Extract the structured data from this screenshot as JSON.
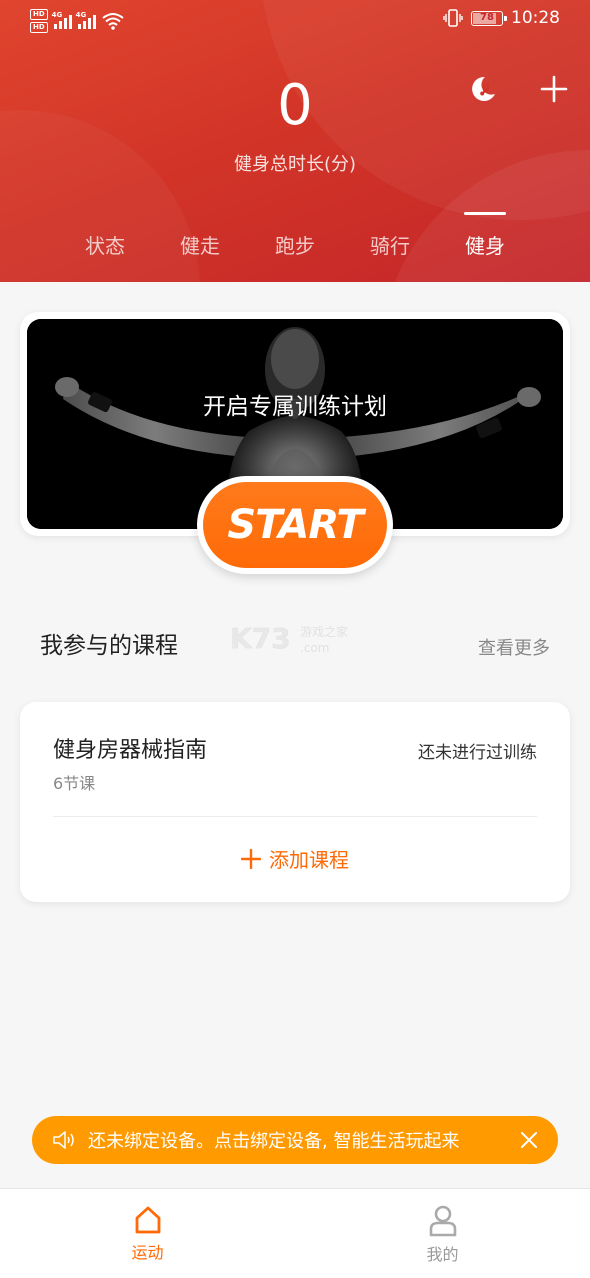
{
  "status_bar": {
    "sim1": "HD",
    "sim2": "HD",
    "network1": "4G",
    "network2": "4G",
    "battery": "78",
    "battery_level": 0.78,
    "time": "10:28"
  },
  "header": {
    "total_value": "0",
    "total_label": "健身总时长(分)",
    "icons": [
      "sleep-music-icon",
      "plus-icon"
    ],
    "tabs": [
      {
        "label": "状态",
        "active": false
      },
      {
        "label": "健走",
        "active": false
      },
      {
        "label": "跑步",
        "active": false
      },
      {
        "label": "骑行",
        "active": false
      },
      {
        "label": "健身",
        "active": true
      }
    ]
  },
  "banner": {
    "title": "开启专属训练计划",
    "start_label": "START"
  },
  "courses": {
    "section_title": "我参与的课程",
    "more_label": "查看更多",
    "watermark_text": "K73 游戏之家 .com",
    "items": [
      {
        "name": "健身房器械指南",
        "count": "6节课",
        "status": "还未进行过训练"
      }
    ],
    "add_label": "添加课程"
  },
  "notice": {
    "text": "还未绑定设备。点击绑定设备, 智能生活玩起来"
  },
  "bottom_nav": [
    {
      "label": "运动",
      "icon": "home-icon",
      "active": true
    },
    {
      "label": "我的",
      "icon": "person-icon",
      "active": false
    }
  ],
  "colors": {
    "header": "#d23527",
    "accent": "#ff6a06",
    "notice": "#ff9a00"
  }
}
